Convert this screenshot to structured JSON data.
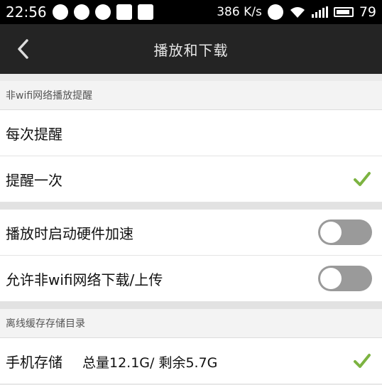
{
  "status": {
    "time": "22:56",
    "net_speed": "386 K/s",
    "battery_level": "79",
    "icons_left": [
      "sync-icon",
      "check-circle-icon",
      "sync-icon",
      "image-icon",
      "clipboard-icon"
    ],
    "icons_right": [
      "alarm-icon",
      "wifi-icon",
      "signal-icon",
      "battery-icon"
    ]
  },
  "header": {
    "title": "播放和下载",
    "back_icon": "chevron-left-icon"
  },
  "section1": {
    "header": "非wifi网络播放提醒",
    "options": [
      {
        "label": "每次提醒",
        "selected": false
      },
      {
        "label": "提醒一次",
        "selected": true
      }
    ]
  },
  "section2": {
    "toggles": [
      {
        "label": "播放时启动硬件加速",
        "on": false
      },
      {
        "label": "允许非wifi网络下载/上传",
        "on": false
      }
    ]
  },
  "section3": {
    "header": "离线缓存存储目录",
    "storage": {
      "label": "手机存储",
      "detail": "总量12.1G/ 剩余5.7G",
      "selected": true
    }
  },
  "colors": {
    "check": "#7cb341",
    "toggle_off": "#9a9a9a",
    "title_bar": "#242424"
  }
}
